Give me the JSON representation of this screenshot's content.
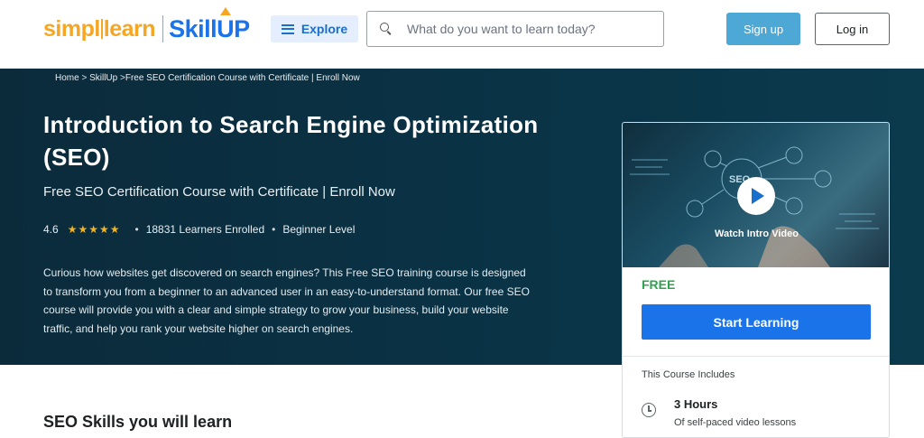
{
  "header": {
    "logo": {
      "simpli": "simpl",
      "learn": "learn",
      "skill": "Skill",
      "up": "UP"
    },
    "explore_label": "Explore",
    "search_placeholder": "What do you want to learn today?",
    "signup_label": "Sign up",
    "login_label": "Log in"
  },
  "breadcrumb": {
    "home": "Home",
    "skillup": "SkillUp",
    "current": "Free SEO Certification Course with Certificate | Enroll Now"
  },
  "hero": {
    "title": "Introduction to Search Engine Optimization (SEO)",
    "subtitle": "Free SEO Certification Course with Certificate | Enroll Now",
    "rating": "4.6",
    "stars": "★★★★★",
    "learners": "18831 Learners Enrolled",
    "level": "Beginner Level",
    "description": "Curious how websites get discovered on search engines? This Free SEO training course is designed to transform you from a beginner to an advanced user in an easy-to-understand format. Our free SEO course will provide you with a clear and simple strategy to grow your business, build your website traffic, and help you rank your website higher on search engines."
  },
  "card": {
    "video_label": "Watch Intro Video",
    "price": "FREE",
    "cta_label": "Start Learning",
    "includes_label": "This Course Includes",
    "hours": "3 Hours",
    "hours_sub": "Of self-paced video lessons"
  },
  "skills_title": "SEO Skills you will learn",
  "colors": {
    "accent_blue": "#1a73e8",
    "signup": "#4ea8d6",
    "free_green": "#2fa44f",
    "star": "#f6b21a",
    "hero_bg": "#0a3346"
  }
}
